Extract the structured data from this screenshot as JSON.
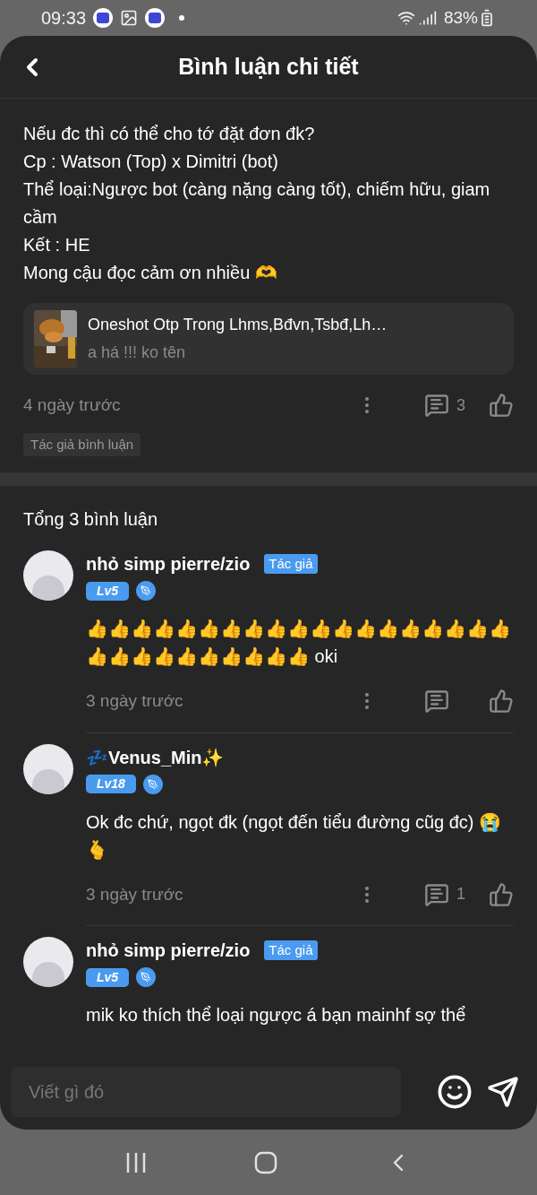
{
  "status_bar": {
    "time": "09:33",
    "battery": "83%"
  },
  "header": {
    "title": "Bình luận chi tiết"
  },
  "post": {
    "lines": [
      "Nếu đc thì có thể cho tớ đặt đơn đk?",
      "Cp : Watson (Top) x Dimitri (bot)",
      "Thể loại:Ngược bot (càng nặng càng tốt), chiếm hữu, giam cầm",
      "Kết : HE",
      "Mong cậu đọc cảm ơn nhiều 🫶"
    ],
    "linked_story": {
      "title": "Oneshot Otp Trong Lhms,Bđvn,Tsbđ,Lh…",
      "author": "a há !!! ko tên"
    },
    "time": "4 ngày trước",
    "reply_count": "3",
    "tag": "Tác giả bình luận"
  },
  "replies_heading": "Tổng 3 bình luận",
  "comments": [
    {
      "name": "nhỏ simp pierre/zio",
      "author_badge": "Tác giả",
      "level": "Lv5",
      "body": "👍👍👍👍👍👍👍👍👍👍👍👍👍👍👍👍👍👍👍👍👍👍👍👍👍👍👍👍👍 oki",
      "time": "3 ngày trước"
    },
    {
      "name": "💤Venus_Min✨",
      "level": "Lv18",
      "body": "Ok đc chứ, ngọt đk (ngọt đến tiểu đường cũg đc) 😭🫰",
      "time": "3 ngày trước",
      "reply_count": "1"
    },
    {
      "name": "nhỏ simp pierre/zio",
      "author_badge": "Tác giả",
      "level": "Lv5",
      "body": "mik ko thích thể loại ngược á bạn mainhf sợ thể"
    }
  ],
  "composer": {
    "placeholder": "Viết gì đó"
  }
}
